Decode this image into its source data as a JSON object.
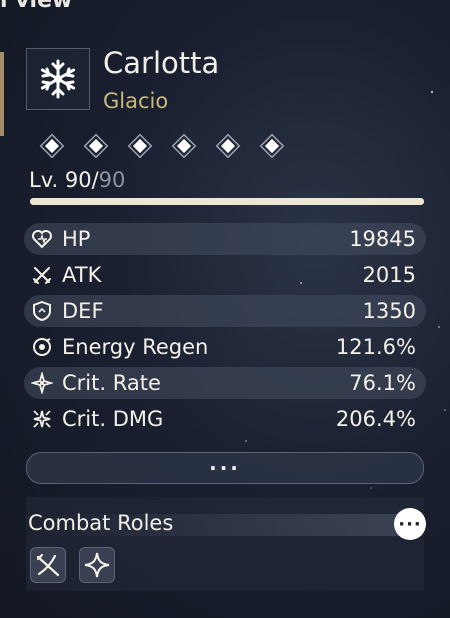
{
  "header": {
    "partial_title": "l view"
  },
  "character": {
    "name": "Carlotta",
    "element": "Glacio",
    "icon": "snowflake-icon",
    "sequence_nodes": 6
  },
  "level": {
    "current": "Lv. 90/",
    "max": "90",
    "progress": 1.0
  },
  "stats": [
    {
      "icon": "heart-icon",
      "label": "HP",
      "value": "19845"
    },
    {
      "icon": "crossed-swords-icon",
      "label": "ATK",
      "value": "2015"
    },
    {
      "icon": "shield-icon",
      "label": "DEF",
      "value": "1350"
    },
    {
      "icon": "energy-regen-icon",
      "label": "Energy Regen",
      "value": "121.6%"
    },
    {
      "icon": "crit-rate-icon",
      "label": "Crit. Rate",
      "value": "76.1%"
    },
    {
      "icon": "crit-dmg-icon",
      "label": "Crit. DMG",
      "value": "206.4%"
    }
  ],
  "more_button": {
    "label": "···"
  },
  "combat_roles": {
    "title": "Combat Roles",
    "info_label": "···",
    "roles": [
      "blade-slash-icon",
      "sparkle-star-icon"
    ]
  },
  "colors": {
    "accent_gold": "#c9b87e",
    "text": "#f4f1e8",
    "muted": "#8c93a2"
  }
}
